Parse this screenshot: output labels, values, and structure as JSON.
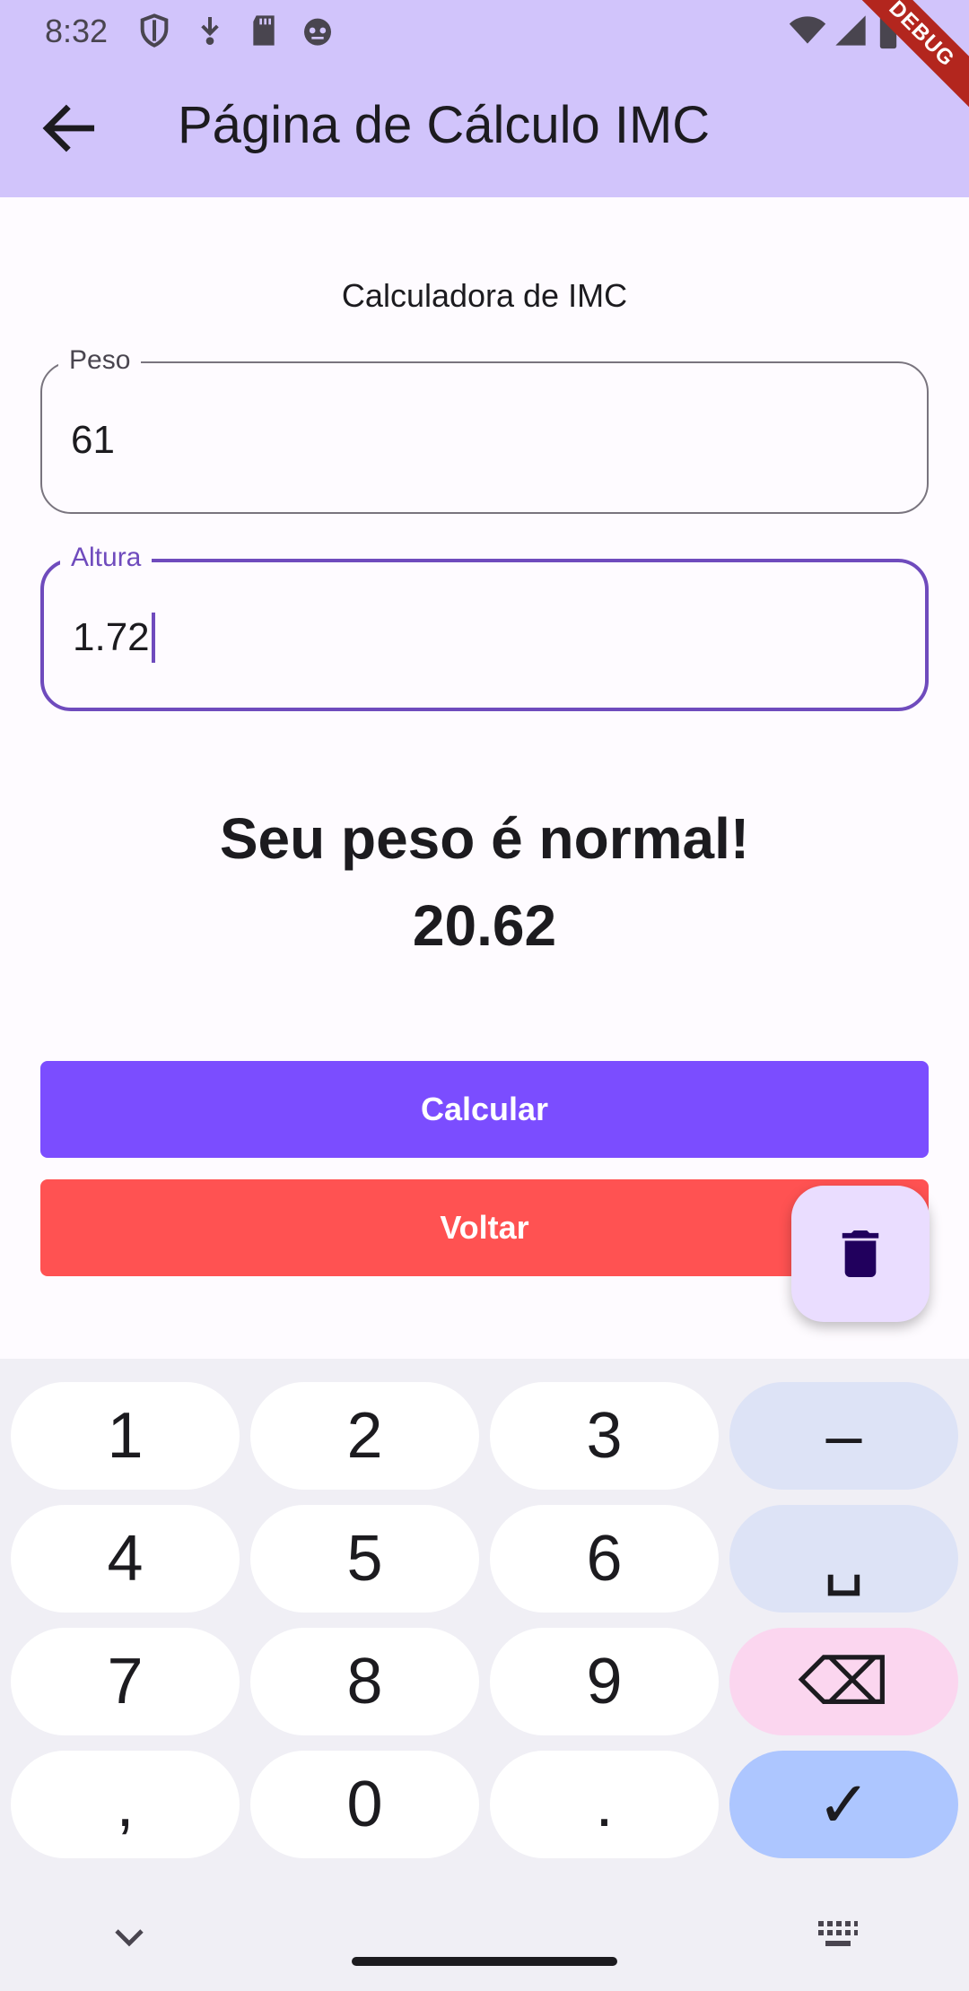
{
  "status_bar": {
    "time": "8:32"
  },
  "app_bar": {
    "title": "Página de Cálculo IMC",
    "debug_banner": "DEBUG"
  },
  "main": {
    "heading": "Calculadora de IMC",
    "peso": {
      "label": "Peso",
      "value": "61"
    },
    "altura": {
      "label": "Altura",
      "value": "1.72"
    },
    "result_message": "Seu peso é normal!",
    "result_value": "20.62",
    "calcular_label": "Calcular",
    "voltar_label": "Voltar"
  },
  "keyboard": {
    "keys": [
      "1",
      "2",
      "3",
      "–",
      "4",
      "5",
      "6",
      "␣",
      "7",
      "8",
      "9",
      "⌫",
      ",",
      "0",
      ".",
      "✓"
    ]
  },
  "colors": {
    "app_bar": "#d1c4fb",
    "primary_button": "#7b4dff",
    "secondary_button": "#ff5252",
    "focus_outline": "#6f4bbd",
    "fab": "#eaddff"
  }
}
